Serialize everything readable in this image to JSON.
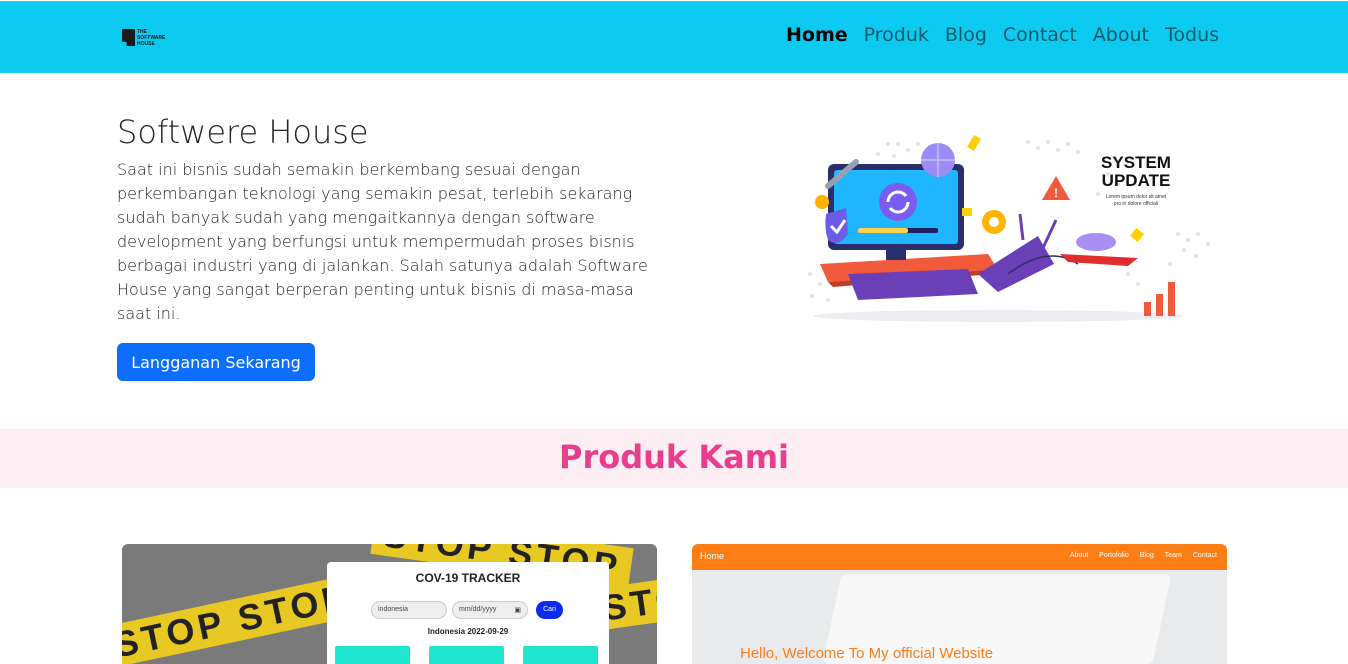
{
  "navbar": {
    "logo_text": [
      "THE",
      "SOFTWARE",
      "HOUSE"
    ],
    "links": [
      {
        "label": "Home",
        "active": true
      },
      {
        "label": "Produk"
      },
      {
        "label": "Blog"
      },
      {
        "label": "Contact"
      },
      {
        "label": "About"
      },
      {
        "label": "Todus"
      }
    ]
  },
  "hero": {
    "title": "Softwere House",
    "description": "Saat ini bisnis sudah semakin berkembang sesuai dengan perkembangan teknologi yang semakin pesat, terlebih sekarang sudah banyak sudah yang mengaitkannya dengan software development yang berfungsi untuk mempermudah proses bisnis berbagai industri yang di jalankan. Salah satunya adalah Software House yang sangat berperan penting untuk bisnis di masa-masa saat ini.",
    "button_label": "Langganan Sekarang",
    "illustration": {
      "heading_line1": "SYSTEM",
      "heading_line2": "UPDATE",
      "caption_line1": "Lorem ipsum dolor sit amet",
      "caption_line2": "pro in dolore officiali"
    }
  },
  "products": {
    "title": "Produk Kami",
    "card1": {
      "tape_text": "STOP",
      "tracker_title": "COV-19 TRACKER",
      "country_value": "indonesia",
      "date_placeholder": "mm/dd/yyyy",
      "button_label": "Cari",
      "result_label": "Indonesia 2022-09-29"
    },
    "card2": {
      "nav_home": "Home",
      "nav_links": [
        "About",
        "Portofolio",
        "Blog",
        "Team",
        "Contact"
      ],
      "welcome_text": "Hello, Welcome To My official Website"
    }
  },
  "colors": {
    "navbar": "#0dcaf0",
    "primary_button": "#0d6efd",
    "section_band": "#fdeef4",
    "section_title": "#e83e8c",
    "card2_accent": "#fd7e14"
  }
}
